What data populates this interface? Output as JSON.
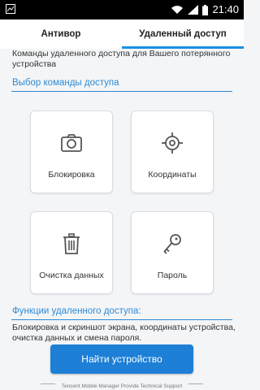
{
  "status_bar": {
    "time": "21:40",
    "icons": [
      "notification-icon",
      "wifi-icon",
      "signal-icon",
      "battery-icon"
    ]
  },
  "tabs": [
    {
      "label": "Антивор",
      "active": false
    },
    {
      "label": "Удаленный доступ",
      "active": true
    }
  ],
  "intro_text": "Команды удаленного доступа для Вашего потерянного устройства",
  "commands_section": {
    "title": "Выбор команды доступа",
    "items": [
      {
        "label": "Блокировка",
        "icon": "camera-icon"
      },
      {
        "label": "Координаты",
        "icon": "crosshair-icon"
      },
      {
        "label": "Очистка данных",
        "icon": "trash-icon"
      },
      {
        "label": "Пароль",
        "icon": "key-icon"
      }
    ]
  },
  "functions_section": {
    "title": "Функции удаленного доступа:",
    "text": "Блокировка и скриншот экрана, координаты устройства, очистка данных и смена пароля."
  },
  "find_button": {
    "label": "Найти устройство"
  },
  "footer": {
    "text": "Tencent Mobile Manager Provide Technical Support"
  },
  "colors": {
    "accent": "#1a8fe0",
    "section_title": "#2d8ad4",
    "button": "#1d7fd6"
  }
}
